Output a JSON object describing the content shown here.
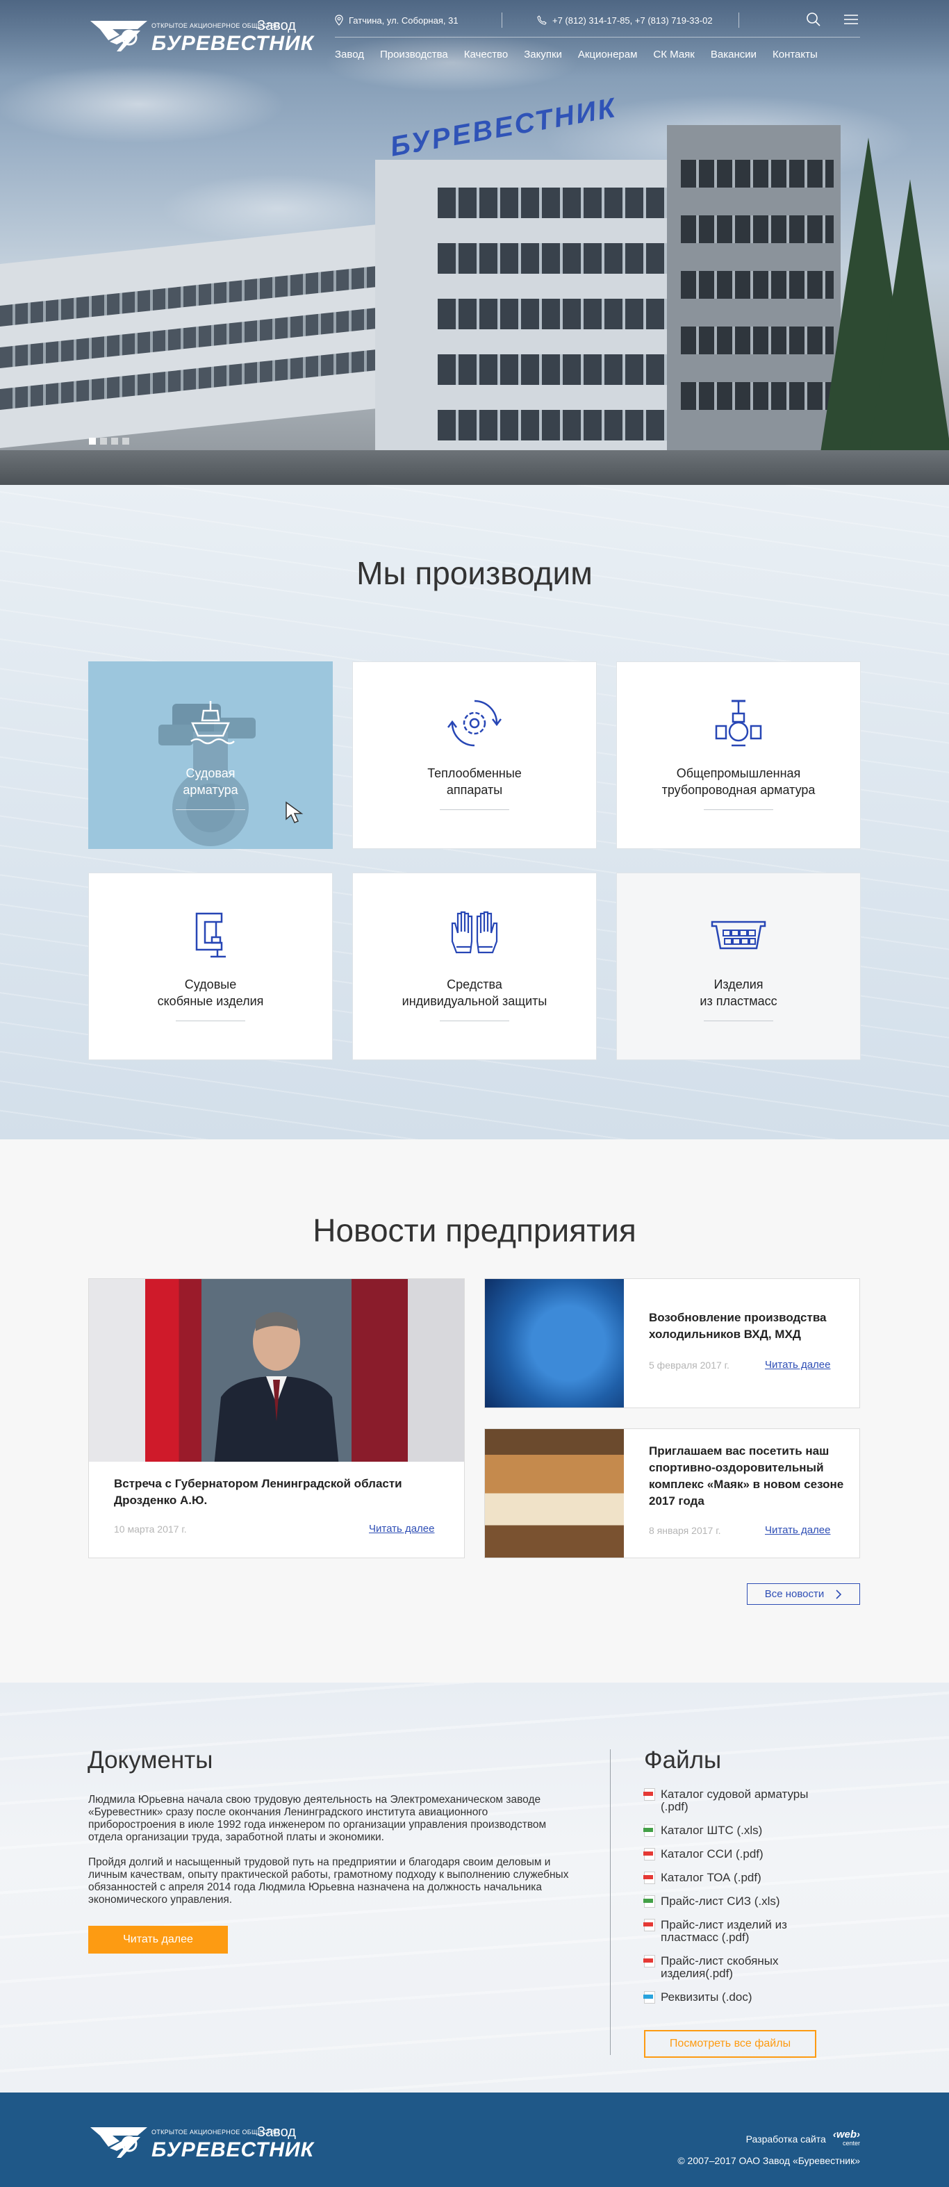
{
  "header": {
    "logo_sub": "открытое акционерное общество",
    "logo_zavod": "Завод",
    "logo_brand": "БУРЕВЕСТНИК",
    "address": "Гатчина, ул. Соборная, 31",
    "phones": "+7 (812) 314-17-85, +7 (813) 719-33-02",
    "nav": [
      "Завод",
      "Производства",
      "Качество",
      "Закупки",
      "Акционерам",
      "СК Маяк",
      "Вакансии",
      "Контакты"
    ]
  },
  "hero": {
    "sign_text": "БУРЕВЕСТНИК",
    "slides": 4,
    "active_slide": 1
  },
  "produce": {
    "title": "Мы производим",
    "cards": [
      {
        "label": "Судовая\nарматура",
        "icon": "ship-icon"
      },
      {
        "label": "Теплообменные\nаппараты",
        "icon": "gear-cycle-icon"
      },
      {
        "label": "Общепромышленная\nтрубопроводная арматура",
        "icon": "valve-icon"
      },
      {
        "label": "Судовые\nскобяные изделия",
        "icon": "clamp-icon"
      },
      {
        "label": "Средства\nиндивидуальной защиты",
        "icon": "gloves-icon"
      },
      {
        "label": "Изделия\nиз пластмасс",
        "icon": "plastic-crate-icon"
      }
    ]
  },
  "news": {
    "title": "Новости предприятия",
    "items": [
      {
        "title": "Встреча с Губернатором Ленинградской области Дрозденко А.Ю.",
        "date": "10 марта 2017 г.",
        "more": "Читать далее"
      },
      {
        "title": "Возобновление производства холодильников ВХД, МХД",
        "date": "5 февраля 2017 г.",
        "more": "Читать далее"
      },
      {
        "title": "Приглашаем вас посетить наш спортивно-оздоровительный комплекс «Маяк» в новом сезоне 2017 года",
        "date": "8 января 2017 г.",
        "more": "Читать далее"
      }
    ],
    "all_label": "Все новости"
  },
  "documents": {
    "title": "Документы",
    "p1": "Людмила Юрьевна начала свою трудовую деятельность на Электромеханическом заводе «Буревестник» сразу после окончания Ленинградского института авиационного приборостроения в июле 1992 года инженером по организации управления производством отдела организации труда, заработной платы и экономики.",
    "p2": "Пройдя долгий и насыщенный трудовой путь на предприятии и благодаря своим деловым и личным качествам, опыту практической работы, грамотному подходу к выполнению служебных обязанностей с апреля 2014 года Людмила Юрьевна назначена на должность начальника экономического управления.",
    "read_label": "Читать далее"
  },
  "files": {
    "title": "Файлы",
    "items": [
      {
        "name": "Каталог судовой арматуры (.pdf)",
        "type": "pdf",
        "color": "#e53935"
      },
      {
        "name": "Каталог ШТС  (.xls)",
        "type": "xls",
        "color": "#43a047"
      },
      {
        "name": "Каталог ССИ (.pdf)",
        "type": "pdf",
        "color": "#e53935"
      },
      {
        "name": "Каталог ТОА (.pdf)",
        "type": "pdf",
        "color": "#e53935"
      },
      {
        "name": "Прайс-лист СИЗ (.xls)",
        "type": "xls",
        "color": "#43a047"
      },
      {
        "name": "Прайс-лист изделий из пластмасс (.pdf)",
        "type": "pdf",
        "color": "#e53935"
      },
      {
        "name": "Прайс-лист скобяных изделия(.pdf)",
        "type": "pdf",
        "color": "#e53935"
      },
      {
        "name": "Реквизиты (.doc)",
        "type": "doc",
        "color": "#29a3dd"
      }
    ],
    "all_label": "Посмотреть все файлы"
  },
  "footer": {
    "dev_label": "Разработка сайта",
    "dev_brand": "‹web›",
    "dev_brand_sub": "center",
    "copyright": "© 2007–2017  ОАО Завод «Буревестник»"
  },
  "colors": {
    "accent": "#fd9b12",
    "link": "#2e4eb5",
    "footer": "#1f5888",
    "active_card": "#9cc6dd"
  }
}
